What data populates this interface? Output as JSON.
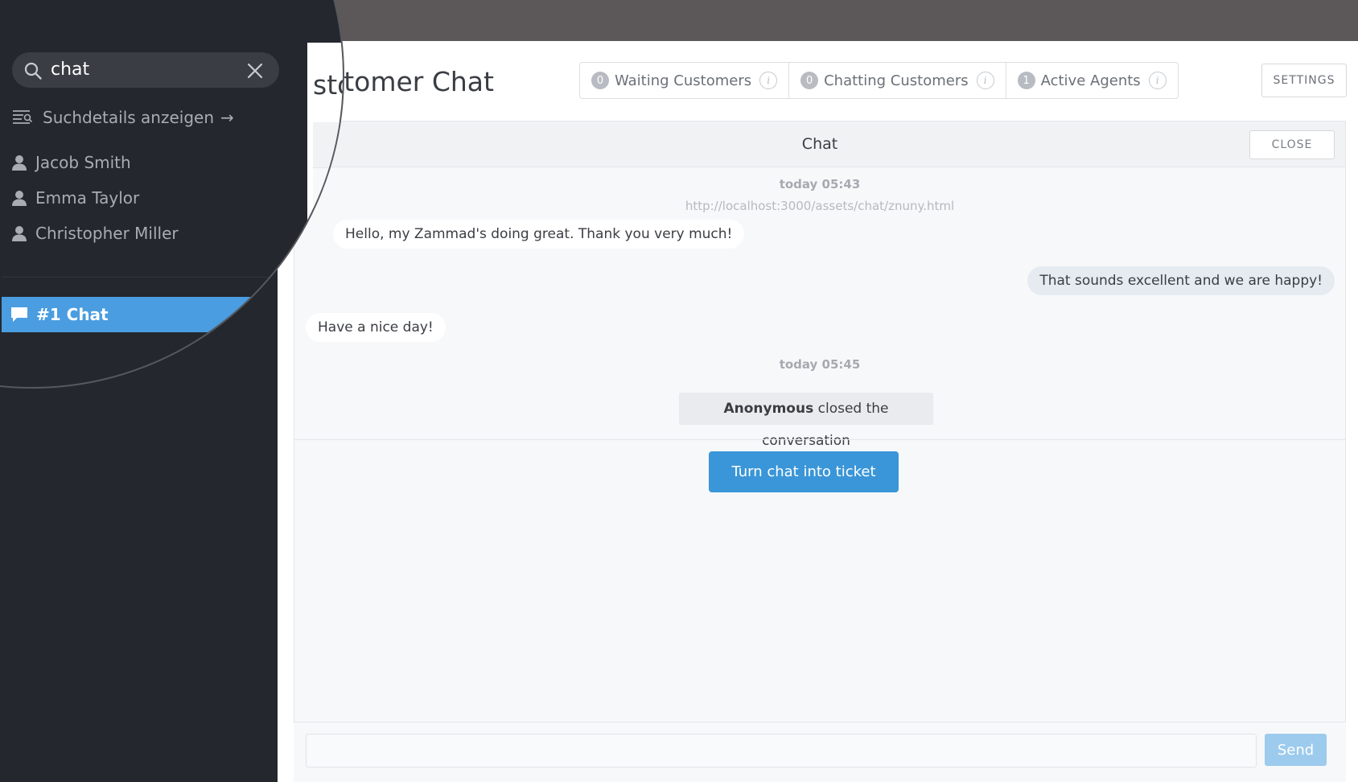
{
  "page": {
    "title": "Customer Chat",
    "title_visible": "stomer Chat",
    "settings_label": "SETTINGS"
  },
  "stats": [
    {
      "count": "0",
      "label": "Waiting Customers"
    },
    {
      "count": "0",
      "label": "Chatting Customers"
    },
    {
      "count": "1",
      "label": "Active Agents"
    }
  ],
  "chat": {
    "header_title": "Chat",
    "close_label": "CLOSE",
    "timestamp_1": "today 05:43",
    "source_url": "http://localhost:3000/assets/chat/znuny.html",
    "messages": [
      {
        "from": "customer",
        "text": "Hello, my Zammad's doing great. Thank you very much!",
        "visible_text": "ello, my Zammad's doing great. Thank you very much!"
      },
      {
        "from": "agent",
        "text": "That sounds excellent and we are happy!"
      },
      {
        "from": "customer",
        "text": "Have a nice day!"
      }
    ],
    "timestamp_2": "today 05:45",
    "status_actor": "Anonymous",
    "status_text": " closed the conversation",
    "ticket_button_label": "Turn chat into ticket",
    "send_label": "Send"
  },
  "search": {
    "query": "chat",
    "details_link": "Suchdetails anzeigen",
    "details_arrow": "→",
    "people": [
      "Jacob Smith",
      "Emma Taylor",
      "Christopher Miller"
    ],
    "chat_result": "#1 Chat"
  },
  "colors": {
    "titlebar": "#5c5758",
    "sidebar": "#24272e",
    "accent": "#3a96d8",
    "highlight": "#4a9de0"
  },
  "icons": {
    "search": "search-icon",
    "clear": "close-icon",
    "details": "search-details-icon",
    "person": "person-icon",
    "chat": "chat-bubble-icon",
    "info": "info-icon"
  }
}
